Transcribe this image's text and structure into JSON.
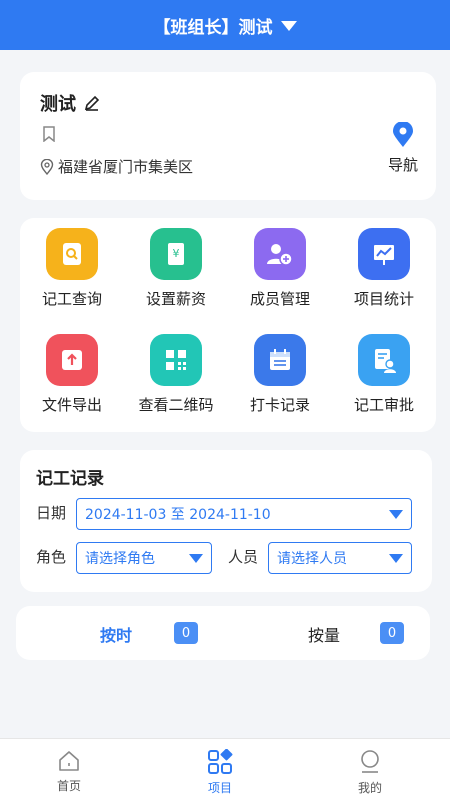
{
  "header": {
    "title": "【班组长】测试"
  },
  "project": {
    "name": "测试",
    "address": "福建省厦门市集美区",
    "nav_label": "导航"
  },
  "grid": {
    "items": [
      {
        "label": "记工查询",
        "icon": "search-doc-icon",
        "color": "#f6b21b"
      },
      {
        "label": "设置薪资",
        "icon": "salary-icon",
        "color": "#27c08f"
      },
      {
        "label": "成员管理",
        "icon": "members-icon",
        "color": "#8c6af0"
      },
      {
        "label": "项目统计",
        "icon": "stats-icon",
        "color": "#3d6ff1"
      },
      {
        "label": "文件导出",
        "icon": "export-icon",
        "color": "#f0525c"
      },
      {
        "label": "查看二维码",
        "icon": "qrcode-icon",
        "color": "#22c6b6"
      },
      {
        "label": "打卡记录",
        "icon": "calendar-icon",
        "color": "#3b79ea"
      },
      {
        "label": "记工审批",
        "icon": "approve-icon",
        "color": "#3aa2f2"
      }
    ]
  },
  "records": {
    "title": "记工记录",
    "date_label": "日期",
    "date_range": "2024-11-03 至 2024-11-10",
    "role_label": "角色",
    "role_placeholder": "请选择角色",
    "person_label": "人员",
    "person_placeholder": "请选择人员"
  },
  "tabs": {
    "by_time": "按时",
    "by_time_count": "0",
    "by_quantity": "按量",
    "by_quantity_count": "0"
  },
  "bottom_nav": {
    "home": "首页",
    "project": "项目",
    "mine": "我的"
  },
  "colors": {
    "accent": "#2f7af2"
  }
}
